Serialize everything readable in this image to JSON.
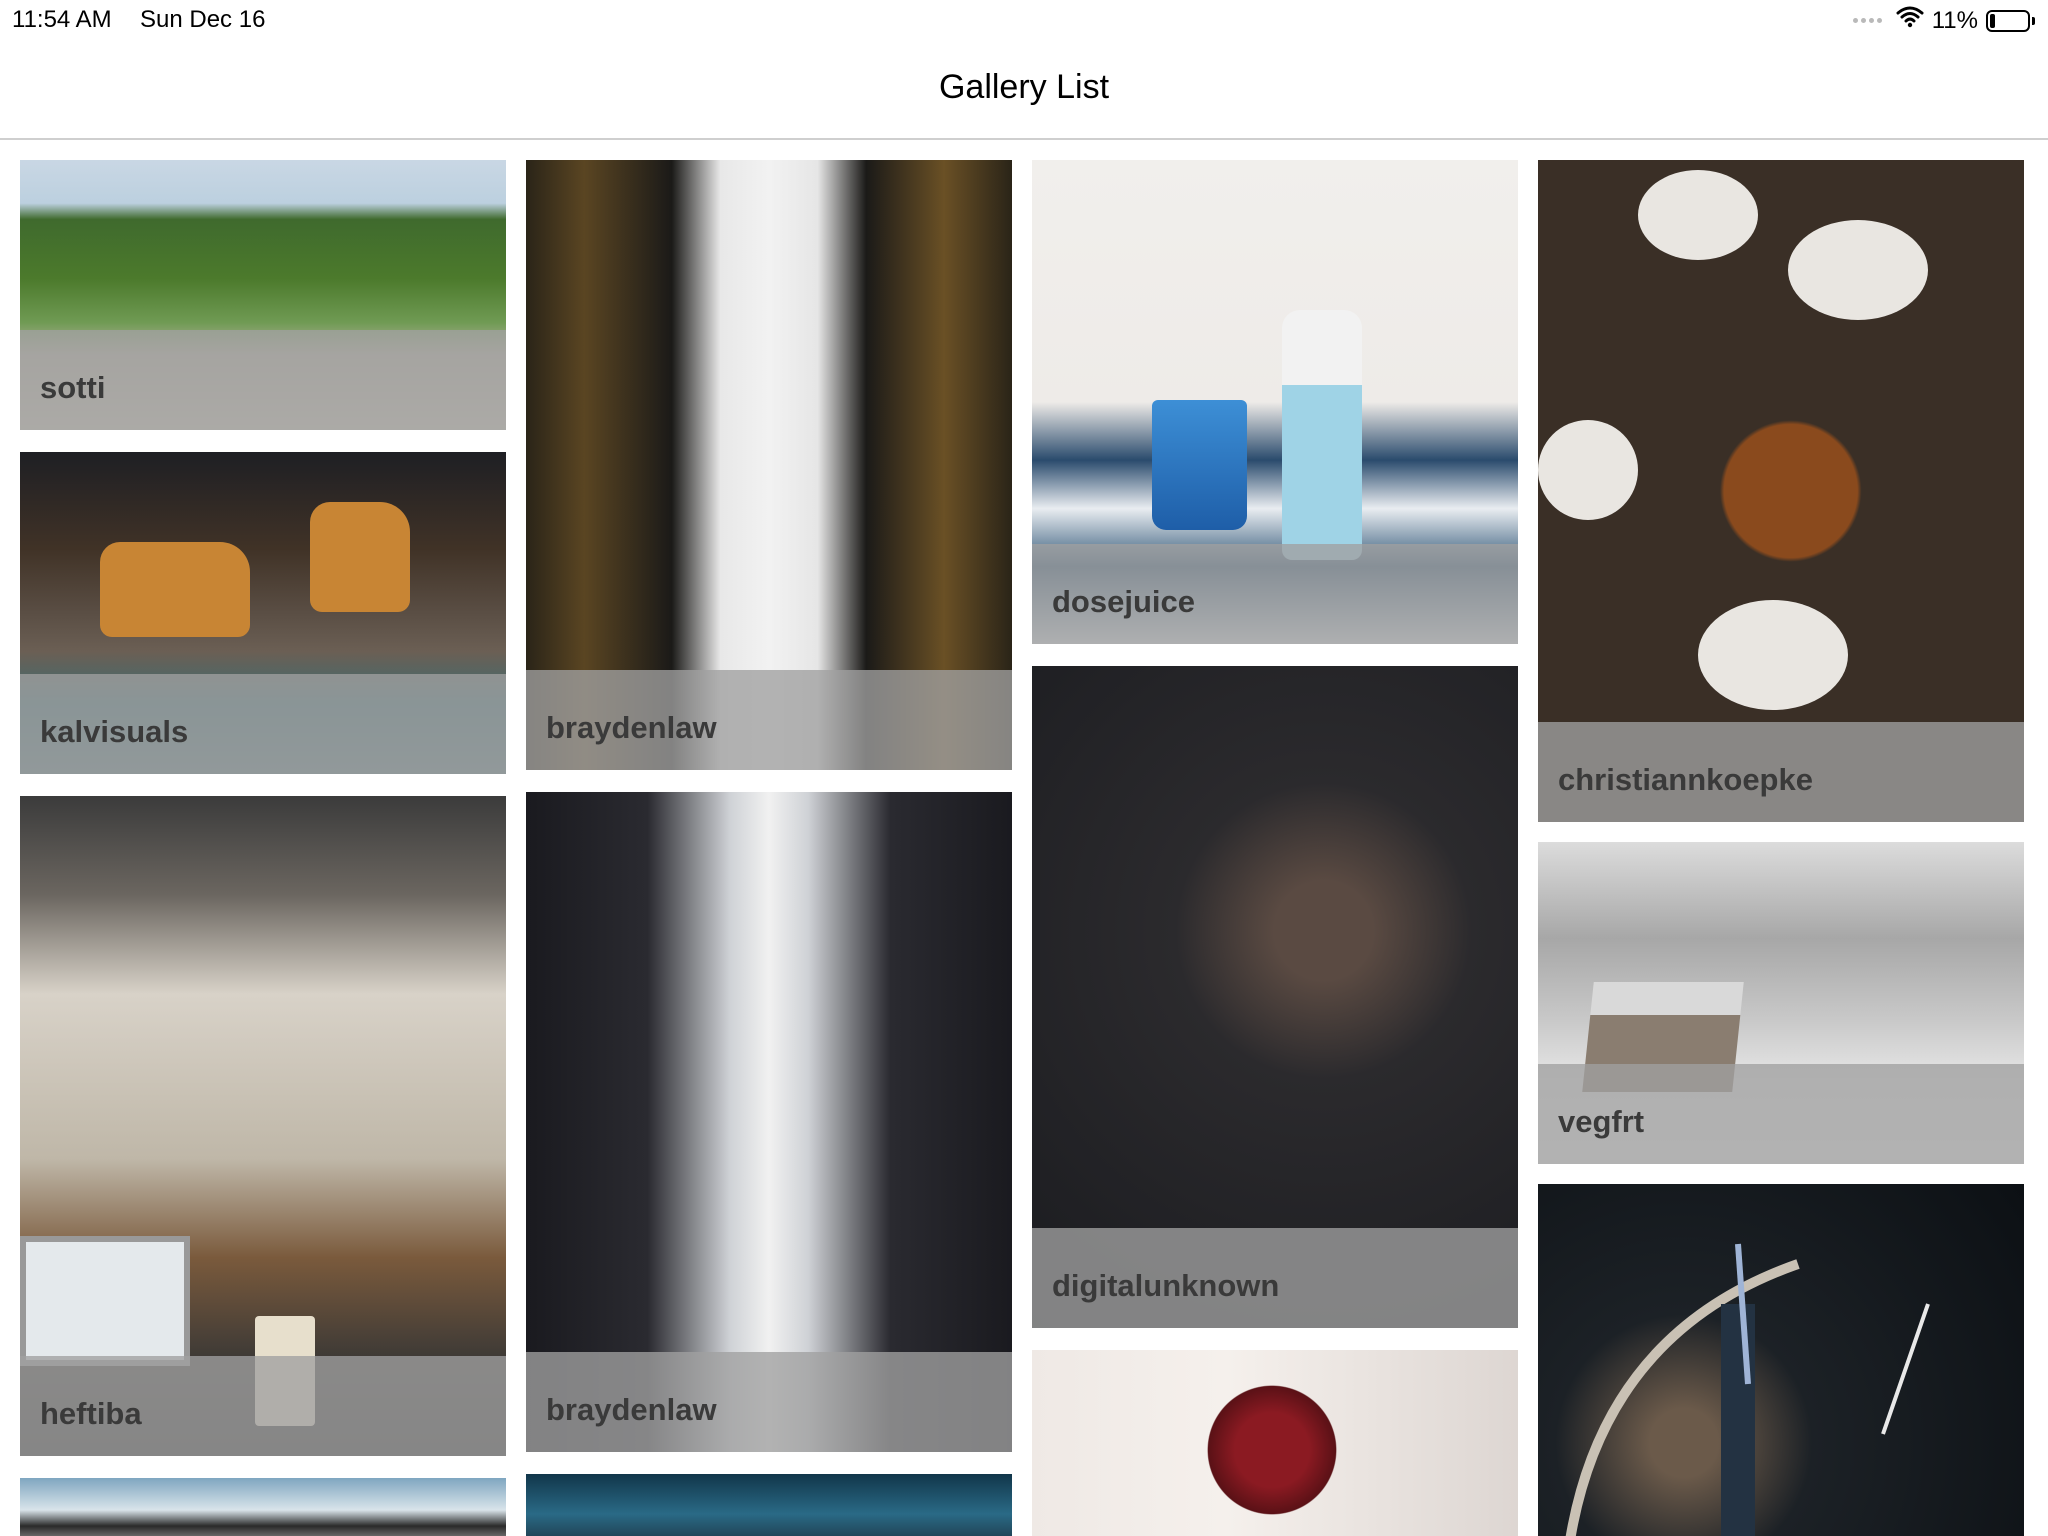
{
  "status_bar": {
    "time": "11:54 AM",
    "date": "Sun Dec 16",
    "battery": "11%"
  },
  "nav": {
    "title": "Gallery List"
  },
  "gallery": {
    "items": [
      {
        "author": "sotti"
      },
      {
        "author": "kalvisuals"
      },
      {
        "author": "heftiba"
      },
      {
        "author": "braydenlaw"
      },
      {
        "author": "braydenlaw"
      },
      {
        "author": "dosejuice"
      },
      {
        "author": "digitalunknown"
      },
      {
        "author": "christiannkoepke"
      },
      {
        "author": "vegfrt"
      }
    ]
  }
}
